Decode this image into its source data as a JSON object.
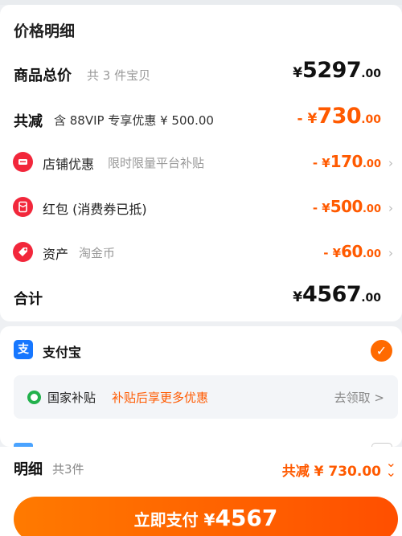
{
  "section_title": "价格明细",
  "goods_total": {
    "label": "商品总价",
    "sub": "共 3 件宝贝",
    "currency": "¥",
    "integer": "5297",
    "decimal": ".00"
  },
  "total_discount": {
    "label": "共减",
    "sub": "含 88VIP 专享优惠 ¥ 500.00",
    "prefix": "- ¥",
    "integer": "730",
    "decimal": ".00"
  },
  "discounts": [
    {
      "label": "店铺优惠",
      "sub": "限时限量平台补贴",
      "prefix": "- ¥",
      "integer": "170",
      "decimal": ".00",
      "icon": "store-coupon-icon"
    },
    {
      "label": "红包 (消费券已抵)",
      "sub": "",
      "prefix": "- ¥",
      "integer": "500",
      "decimal": ".00",
      "icon": "red-packet-icon"
    },
    {
      "label": "资产",
      "sub": "淘金币",
      "prefix": "- ¥",
      "integer": "60",
      "decimal": ".00",
      "icon": "coin-tag-icon"
    }
  ],
  "sum": {
    "label": "合计",
    "currency": "¥",
    "integer": "4567",
    "decimal": ".00"
  },
  "payment": {
    "method": "支付宝",
    "icon_glyph": "支",
    "selected": true
  },
  "subsidy": {
    "title": "国家补贴",
    "promo": "补贴后享更多优惠",
    "claim": "去领取 >"
  },
  "footer": {
    "detail_label": "明细",
    "count": "共3件",
    "saving": "共减 ¥ 730.00"
  },
  "pay_button": {
    "label": "立即支付 ¥",
    "amount": "4567"
  },
  "colors": {
    "accent": "#ff5a00",
    "alipay": "#1677ff",
    "icon_red": "#f2273b",
    "green": "#22b14c"
  }
}
